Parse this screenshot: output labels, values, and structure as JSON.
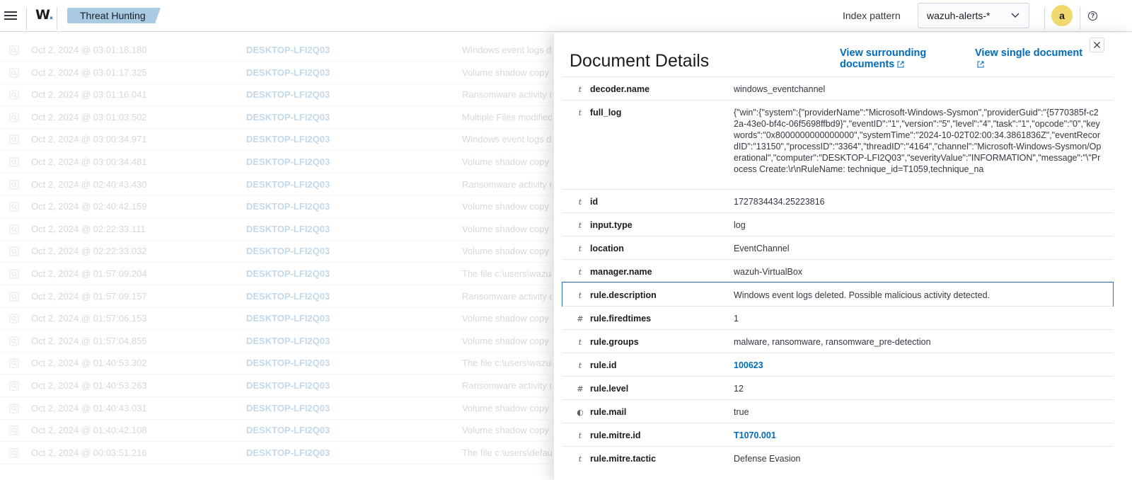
{
  "header": {
    "app_title": "Threat Hunting",
    "logo_text": "W",
    "index_pattern_label": "Index pattern",
    "index_pattern_value": "wazuh-alerts-*",
    "avatar_letter": "a"
  },
  "table": {
    "rows": [
      {
        "time": "Oct 2, 2024 @ 03:01:18.180",
        "agent": "DESKTOP-LFI2Q03",
        "description": "Windows event logs deleted"
      },
      {
        "time": "Oct 2, 2024 @ 03:01:17.325",
        "agent": "DESKTOP-LFI2Q03",
        "description": "Volume shadow copy deleted"
      },
      {
        "time": "Oct 2, 2024 @ 03:01:16.041",
        "agent": "DESKTOP-LFI2Q03",
        "description": "Ransomware activity detected"
      },
      {
        "time": "Oct 2, 2024 @ 03:01:03.502",
        "agent": "DESKTOP-LFI2Q03",
        "description": "Multiple Files modified"
      },
      {
        "time": "Oct 2, 2024 @ 03:00:34.971",
        "agent": "DESKTOP-LFI2Q03",
        "description": "Windows event logs deleted"
      },
      {
        "time": "Oct 2, 2024 @ 03:00:34.481",
        "agent": "DESKTOP-LFI2Q03",
        "description": "Volume shadow copy deleted"
      },
      {
        "time": "Oct 2, 2024 @ 02:40:43.430",
        "agent": "DESKTOP-LFI2Q03",
        "description": "Ransomware activity detected"
      },
      {
        "time": "Oct 2, 2024 @ 02:40:42.159",
        "agent": "DESKTOP-LFI2Q03",
        "description": "Volume shadow copy deleted"
      },
      {
        "time": "Oct 2, 2024 @ 02:22:33.111",
        "agent": "DESKTOP-LFI2Q03",
        "description": "Volume shadow copy deleted"
      },
      {
        "time": "Oct 2, 2024 @ 02:22:33.032",
        "agent": "DESKTOP-LFI2Q03",
        "description": "Volume shadow copy deleted"
      },
      {
        "time": "Oct 2, 2024 @ 01:57:09.204",
        "agent": "DESKTOP-LFI2Q03",
        "description": "The file c:\\users\\wazuh"
      },
      {
        "time": "Oct 2, 2024 @ 01:57:09.157",
        "agent": "DESKTOP-LFI2Q03",
        "description": "Ransomware activity detected"
      },
      {
        "time": "Oct 2, 2024 @ 01:57:06.153",
        "agent": "DESKTOP-LFI2Q03",
        "description": "Volume shadow copy deleted"
      },
      {
        "time": "Oct 2, 2024 @ 01:57:04.855",
        "agent": "DESKTOP-LFI2Q03",
        "description": "Volume shadow copy deleted"
      },
      {
        "time": "Oct 2, 2024 @ 01:40:53.302",
        "agent": "DESKTOP-LFI2Q03",
        "description": "The file c:\\users\\wazuh"
      },
      {
        "time": "Oct 2, 2024 @ 01:40:53.263",
        "agent": "DESKTOP-LFI2Q03",
        "description": "Ransomware activity detected"
      },
      {
        "time": "Oct 2, 2024 @ 01:40:43.031",
        "agent": "DESKTOP-LFI2Q03",
        "description": "Volume shadow copy deleted"
      },
      {
        "time": "Oct 2, 2024 @ 01:40:42.108",
        "agent": "DESKTOP-LFI2Q03",
        "description": "Volume shadow copy deleted"
      },
      {
        "time": "Oct 2, 2024 @ 00:03:51.216",
        "agent": "DESKTOP-LFI2Q03",
        "description": "The file c:\\users\\default"
      }
    ]
  },
  "flyout": {
    "title": "Document Details",
    "link_surrounding_line1": "View surrounding",
    "link_surrounding_line2": "documents",
    "link_single": "View single document",
    "fields": [
      {
        "type": "t",
        "name": "decoder.name",
        "value": "windows_eventchannel"
      },
      {
        "type": "t",
        "name": "full_log",
        "value": "{\"win\":{\"system\":{\"providerName\":\"Microsoft-Windows-Sysmon\",\"providerGuid\":\"{5770385f-c22a-43e0-bf4c-06f5698ffbd9}\",\"eventID\":\"1\",\"version\":\"5\",\"level\":\"4\",\"task\":\"1\",\"opcode\":\"0\",\"keywords\":\"0x8000000000000000\",\"systemTime\":\"2024-10-02T02:00:34.3861836Z\",\"eventRecordID\":\"13150\",\"processID\":\"3364\",\"threadID\":\"4164\",\"channel\":\"Microsoft-Windows-Sysmon/Operational\",\"computer\":\"DESKTOP-LFI2Q03\",\"severityValue\":\"INFORMATION\",\"message\":\"\\\"Process Create:\\r\\nRuleName: technique_id=T1059,technique_na"
      },
      {
        "type": "t",
        "name": "id",
        "value": "1727834434.25223816"
      },
      {
        "type": "t",
        "name": "input.type",
        "value": "log"
      },
      {
        "type": "t",
        "name": "location",
        "value": "EventChannel"
      },
      {
        "type": "t",
        "name": "manager.name",
        "value": "wazuh-VirtualBox"
      },
      {
        "type": "t",
        "name": "rule.description",
        "value": "Windows event logs deleted. Possible malicious activity detected."
      },
      {
        "type": "#",
        "name": "rule.firedtimes",
        "value": "1"
      },
      {
        "type": "t",
        "name": "rule.groups",
        "value": "malware, ransomware, ransomware_pre-detection"
      },
      {
        "type": "t",
        "name": "rule.id",
        "value": "100623"
      },
      {
        "type": "#",
        "name": "rule.level",
        "value": "12"
      },
      {
        "type": "◐",
        "name": "rule.mail",
        "value": "true"
      },
      {
        "type": "t",
        "name": "rule.mitre.id",
        "value": "T1070.001"
      },
      {
        "type": "t",
        "name": "rule.mitre.tactic",
        "value": "Defense Evasion"
      }
    ]
  }
}
